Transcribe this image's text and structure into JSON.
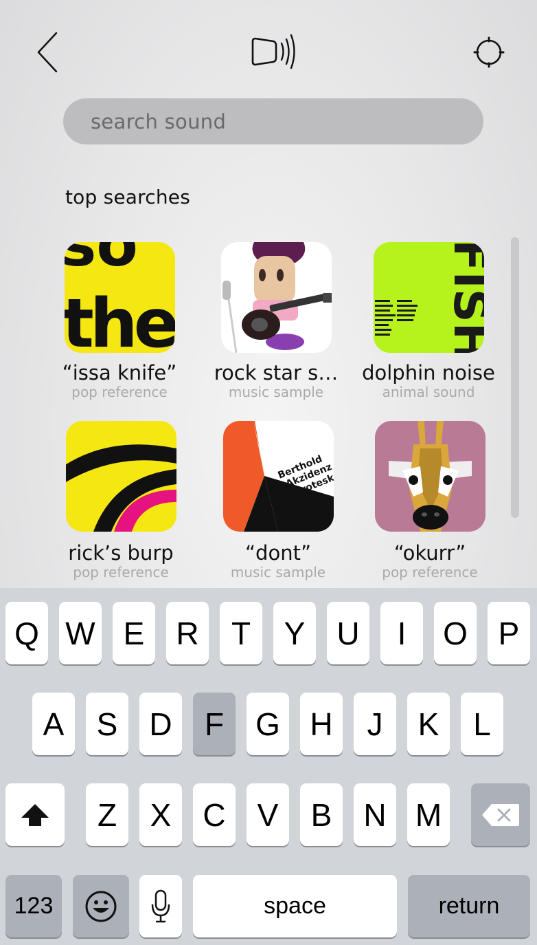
{
  "header": {
    "back_icon": "chevron-left-icon",
    "center_icon": "speaker-sound-icon",
    "settings_icon": "gear-icon"
  },
  "search": {
    "placeholder": "search sound",
    "value": ""
  },
  "section": {
    "title": "top searches"
  },
  "results": [
    {
      "title": "“issa knife”",
      "category": "pop reference"
    },
    {
      "title": "rock star s…",
      "category": "music sample"
    },
    {
      "title": "dolphin noise",
      "category": "animal sound"
    },
    {
      "title": "rick’s burp",
      "category": "pop reference"
    },
    {
      "title": "“dont”",
      "category": "music sample"
    },
    {
      "title": "“okurr”",
      "category": "pop reference"
    }
  ],
  "thumb_text": {
    "poster1": [
      "so",
      "the"
    ],
    "poster3": "FISH",
    "poster5": [
      "Berthold",
      "Akzidenz",
      "Grotesk"
    ]
  },
  "keyboard": {
    "row1": [
      "Q",
      "W",
      "E",
      "R",
      "T",
      "Y",
      "U",
      "I",
      "O",
      "P"
    ],
    "row2": [
      "A",
      "S",
      "D",
      "F",
      "G",
      "H",
      "J",
      "K",
      "L"
    ],
    "row3": [
      "Z",
      "X",
      "C",
      "V",
      "B",
      "N",
      "M"
    ],
    "pressed_key": "F",
    "numbers_label": "123",
    "space_label": "space",
    "return_label": "return",
    "shift_icon": "shift-arrow-icon",
    "delete_icon": "backspace-icon",
    "emoji_icon": "emoji-icon",
    "mic_icon": "microphone-icon"
  },
  "colors": {
    "poster_yellow": "#f5e711",
    "poster_green": "#b6f21b",
    "poster_pink": "#e6127f",
    "poster_orange": "#ef5a28",
    "poster_mauve": "#b97a96",
    "search_bg": "#bdbdbf"
  }
}
